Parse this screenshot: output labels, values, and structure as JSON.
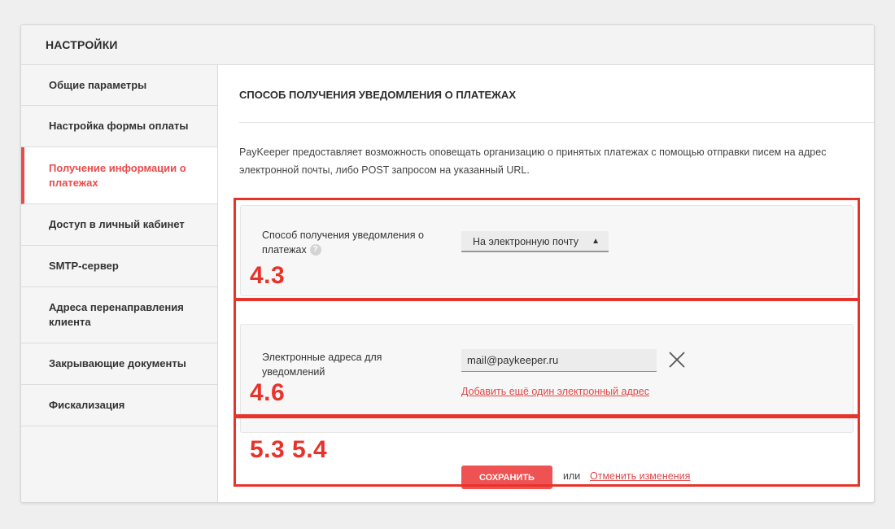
{
  "header": {
    "title": "НАСТРОЙКИ"
  },
  "sidebar": {
    "items": [
      {
        "label": "Общие параметры"
      },
      {
        "label": "Настройка формы оплаты"
      },
      {
        "label": "Получение информации о платежах",
        "active": true
      },
      {
        "label": "Доступ в личный кабинет"
      },
      {
        "label": "SMTP-сервер"
      },
      {
        "label": "Адреса перенаправления клиента"
      },
      {
        "label": "Закрывающие документы"
      },
      {
        "label": "Фискализация"
      }
    ]
  },
  "main": {
    "section_title": "СПОСОБ ПОЛУЧЕНИЯ УВЕДОМЛЕНИЯ О ПЛАТЕЖАХ",
    "intro": "PayKeeper предоставляет возможность оповещать организацию о принятых платежах с помощью отправки писем на адрес электронной почты, либо POST запросом на указанный URL.",
    "method_field": {
      "label": "Способ получения уведомления о платежах",
      "help_icon": "question-icon",
      "help_glyph": "?",
      "selected": "На электронную почту"
    },
    "email_field": {
      "label": "Электронные адреса для уведомлений",
      "value": "mail@paykeeper.ru",
      "add_link": "Добавить ещё один электронный адрес"
    },
    "actions": {
      "save_label": "СОХРАНИТЬ",
      "or_text": "или",
      "cancel_label": "Отменить изменения"
    }
  },
  "annotations": {
    "labels": [
      "4.3",
      "4.6",
      "5.3 5.4"
    ],
    "color": "#e8332b"
  },
  "colors": {
    "accent": "#e94b4b",
    "save_button": "#ee5253",
    "input_focus": "#5cb85c"
  }
}
